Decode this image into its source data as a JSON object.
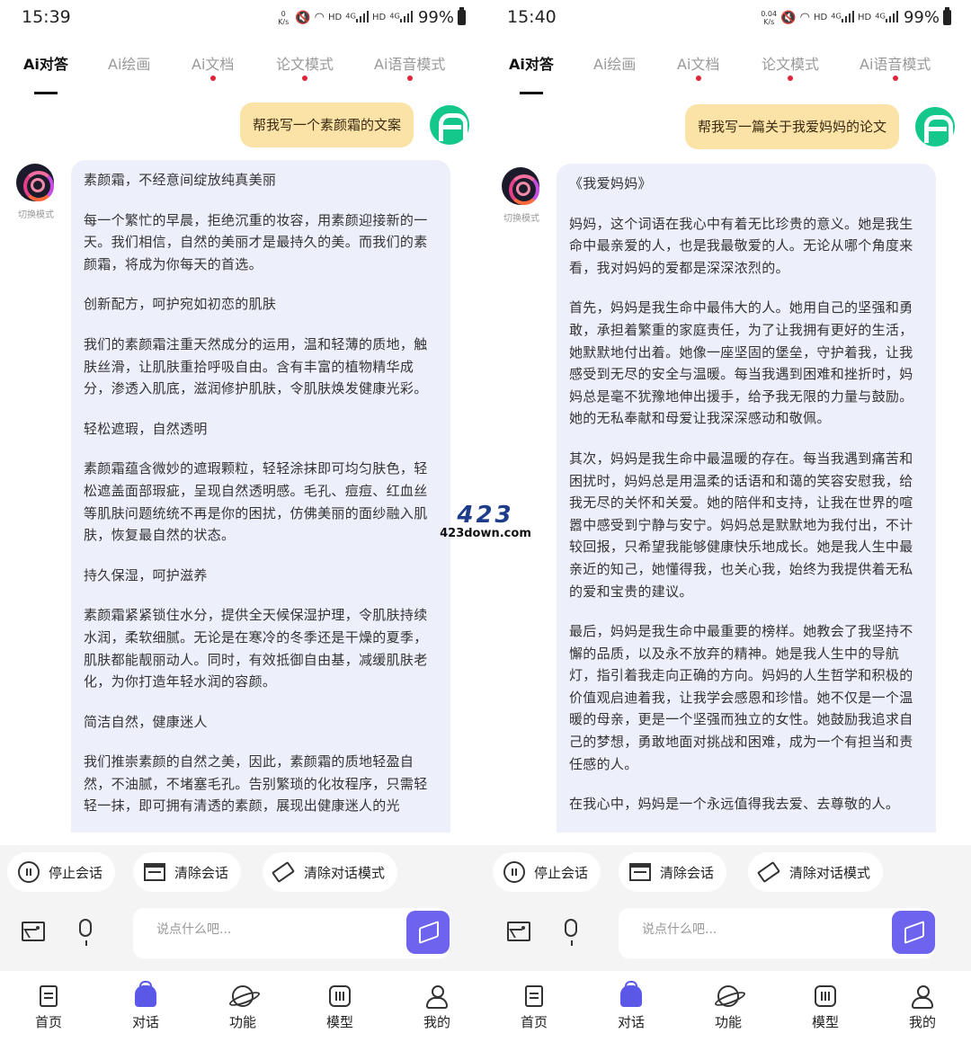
{
  "screens": [
    {
      "status": {
        "time": "15:39",
        "speed_value": "0",
        "speed_unit": "K/s",
        "hd1": "HD",
        "net1": "4G",
        "hd2": "HD",
        "net2": "4G",
        "battery": "99%"
      },
      "tabs": [
        {
          "label": "Ai对答",
          "active": true,
          "dot": false
        },
        {
          "label": "Ai绘画",
          "active": false,
          "dot": false
        },
        {
          "label": "Ai文档",
          "active": false,
          "dot": true
        },
        {
          "label": "论文模式",
          "active": false,
          "dot": true
        },
        {
          "label": "Ai语音模式",
          "active": false,
          "dot": true
        }
      ],
      "user_message": "帮我写一个素颜霜的文案",
      "switch_label": "切换模式",
      "bot_paragraphs": [
        "素颜霜，不经意间绽放纯真美丽",
        "每一个繁忙的早晨，拒绝沉重的妆容，用素颜迎接新的一天。我们相信，自然的美丽才是最持久的美。而我们的素颜霜，将成为你每天的首选。",
        "创新配方，呵护宛如初恋的肌肤",
        "我们的素颜霜注重天然成分的运用，温和轻薄的质地，触肤丝滑，让肌肤重拾呼吸自由。含有丰富的植物精华成分，渗透入肌底，滋润修护肌肤，令肌肤焕发健康光彩。",
        "轻松遮瑕，自然透明",
        "素颜霜蕴含微妙的遮瑕颗粒，轻轻涂抹即可均匀肤色，轻松遮盖面部瑕疵，呈现自然透明感。毛孔、痘痘、红血丝等肌肤问题统统不再是你的困扰，仿佛美丽的面纱融入肌肤，恢复最自然的状态。",
        "持久保湿，呵护滋养",
        "素颜霜紧紧锁住水分，提供全天候保湿护理，令肌肤持续水润，柔软细腻。无论是在寒冷的冬季还是干燥的夏季，肌肤都能靓丽动人。同时，有效抵御自由基，减缓肌肤老化，为你打造年轻水润的容颜。",
        "简洁自然，健康迷人",
        "我们推崇素颜的自然之美，因此，素颜霜的质地轻盈自然，不油腻，不堵塞毛孔。告别繁琐的化妆程序，只需轻轻一抹，即可拥有清透的素颜，展现出健康迷人的光"
      ],
      "actions": [
        "停止会话",
        "清除会话",
        "清除对话模式"
      ],
      "input_placeholder": "说点什么吧...",
      "nav": [
        "首页",
        "对话",
        "功能",
        "模型",
        "我的"
      ]
    },
    {
      "status": {
        "time": "15:40",
        "speed_value": "0.04",
        "speed_unit": "K/s",
        "hd1": "HD",
        "net1": "4G",
        "hd2": "HD",
        "net2": "4G",
        "battery": "99%"
      },
      "tabs": [
        {
          "label": "Ai对答",
          "active": true,
          "dot": false
        },
        {
          "label": "Ai绘画",
          "active": false,
          "dot": false
        },
        {
          "label": "Ai文档",
          "active": false,
          "dot": true
        },
        {
          "label": "论文模式",
          "active": false,
          "dot": true
        },
        {
          "label": "Ai语音模式",
          "active": false,
          "dot": true
        }
      ],
      "user_message": "帮我写一篇关于我爱妈妈的论文",
      "switch_label": "切换模式",
      "bot_paragraphs": [
        "《我爱妈妈》",
        "妈妈，这个词语在我心中有着无比珍贵的意义。她是我生命中最亲爱的人，也是我最敬爱的人。无论从哪个角度来看，我对妈妈的爱都是深深浓烈的。",
        "首先，妈妈是我生命中最伟大的人。她用自己的坚强和勇敢，承担着繁重的家庭责任，为了让我拥有更好的生活，她默默地付出着。她像一座坚固的堡垒，守护着我，让我感受到无尽的安全与温暖。每当我遇到困难和挫折时，妈妈总是毫不犹豫地伸出援手，给予我无限的力量与鼓励。她的无私奉献和母爱让我深深感动和敬佩。",
        "其次，妈妈是我生命中最温暖的存在。每当我遇到痛苦和困扰时，妈妈总是用温柔的话语和和蔼的笑容安慰我，给我无尽的关怀和关爱。她的陪伴和支持，让我在世界的喧嚣中感受到宁静与安宁。妈妈总是默默地为我付出，不计较回报，只希望我能够健康快乐地成长。她是我人生中最亲近的知己，她懂得我，也关心我，始终为我提供着无私的爱和宝贵的建议。",
        "最后，妈妈是我生命中最重要的榜样。她教会了我坚持不懈的品质，以及永不放弃的精神。她是我人生中的导航灯，指引着我走向正确的方向。妈妈的人生哲学和积极的价值观启迪着我，让我学会感恩和珍惜。她不仅是一个温暖的母亲，更是一个坚强而独立的女性。她鼓励我追求自己的梦想，勇敢地面对挑战和困难，成为一个有担当和责任感的人。",
        "在我心中，妈妈是一个永远值得我去爱、去尊敬的人。"
      ],
      "actions": [
        "停止会话",
        "清除会话",
        "清除对话模式"
      ],
      "input_placeholder": "说点什么吧...",
      "nav": [
        "首页",
        "对话",
        "功能",
        "模型",
        "我的"
      ]
    }
  ],
  "watermark": {
    "line1": "423",
    "line2": "423down.com"
  },
  "colors": {
    "accent": "#6d63ef",
    "user_bubble": "#fbe3a7",
    "bot_bubble": "#edf0fb",
    "tab_dot": "#e0253a",
    "avatar_green": "#14c78a"
  }
}
